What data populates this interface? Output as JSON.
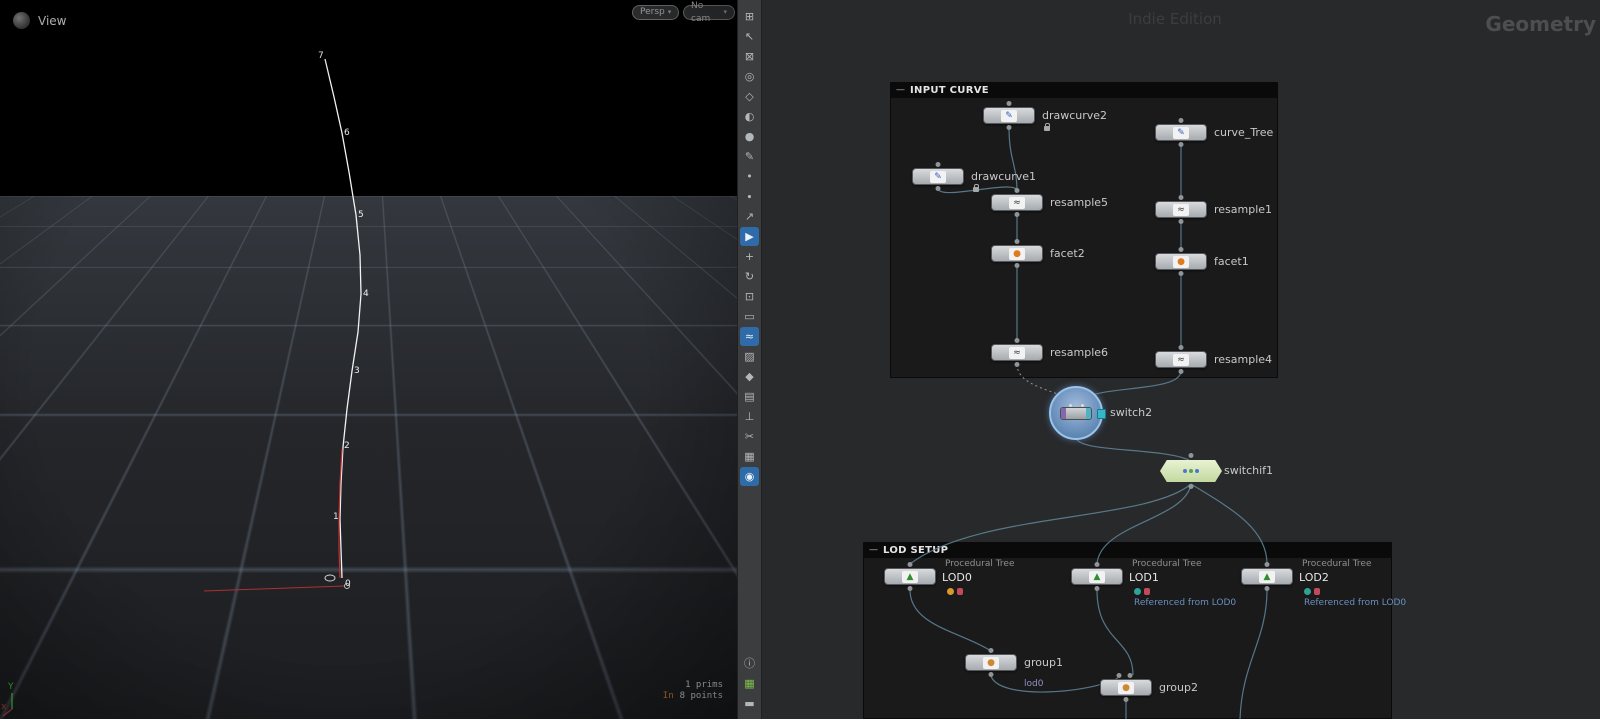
{
  "viewport": {
    "title": "View",
    "camera_button": "Persp",
    "cam_select_button": "No cam",
    "caret": "▾",
    "point_labels": [
      "7",
      "6",
      "5",
      "4",
      "3",
      "2",
      "1",
      "0"
    ],
    "stats": {
      "prims_line": "1  prims",
      "in_label": "In",
      "points_line": "8 points"
    },
    "axis": {
      "x": "x",
      "y": "Y"
    }
  },
  "toolbar": {
    "icons": [
      {
        "name": "viewport-layout-icon",
        "glyph": "⊞"
      },
      {
        "name": "cursor-icon",
        "glyph": "↖"
      },
      {
        "name": "lock-icon",
        "glyph": "⊠"
      },
      {
        "name": "pin-icon",
        "glyph": "◎"
      },
      {
        "name": "diamond-snap-icon",
        "glyph": "◇"
      },
      {
        "name": "shading-icon",
        "glyph": "◐"
      },
      {
        "name": "sphere-icon",
        "glyph": "●"
      },
      {
        "name": "pen-icon",
        "glyph": "✎"
      },
      {
        "name": "dot-icon",
        "glyph": "•"
      },
      {
        "name": "small-dot-icon",
        "glyph": "∙"
      },
      {
        "name": "arrow-tool-icon",
        "glyph": "↗"
      },
      {
        "name": "select-tool-icon",
        "glyph": "▶"
      },
      {
        "name": "translate-tool-icon",
        "glyph": "+"
      },
      {
        "name": "rotate-tool-icon",
        "glyph": "↻"
      },
      {
        "name": "scale-tool-icon",
        "glyph": "⊡"
      },
      {
        "name": "marquee-select-icon",
        "glyph": "▭"
      },
      {
        "name": "curve-tool-icon",
        "glyph": "≈"
      },
      {
        "name": "paint-tool-icon",
        "glyph": "▨"
      },
      {
        "name": "snap-icon",
        "glyph": "◆"
      },
      {
        "name": "grid-snap-icon",
        "glyph": "▤"
      },
      {
        "name": "align-tool-icon",
        "glyph": "⊥"
      },
      {
        "name": "cut-tool-icon",
        "glyph": "✂"
      },
      {
        "name": "mirror-tool-icon",
        "glyph": "▦"
      },
      {
        "name": "light-tool-icon",
        "glyph": "◉"
      },
      {
        "name": "info-icon",
        "glyph": "ⓘ"
      },
      {
        "name": "cells-icon",
        "glyph": "▦"
      },
      {
        "name": "memory-icon",
        "glyph": "▬"
      }
    ]
  },
  "network": {
    "watermark": "Indie Edition",
    "pane_title": "Geometry",
    "input_box": {
      "title": "INPUT CURVE",
      "collapse": "—"
    },
    "lod_box": {
      "title": "LOD SETUP",
      "collapse": "—"
    },
    "glyphs": {
      "draw": "✎",
      "resample": "≈",
      "facet": "●",
      "tree": "▲",
      "group": "●"
    },
    "nodes": [
      {
        "label": "drawcurve2"
      },
      {
        "label": "curve_Tree"
      },
      {
        "label": "drawcurve1"
      },
      {
        "label": "resample5"
      },
      {
        "label": "resample1"
      },
      {
        "label": "facet2"
      },
      {
        "label": "facet1"
      },
      {
        "label": "resample6"
      },
      {
        "label": "resample4"
      }
    ],
    "switch2": {
      "label": "switch2"
    },
    "switchif1": {
      "label": "switchif1"
    },
    "lods": [
      {
        "type": "Procedural Tree",
        "label": "LOD0",
        "ref": ""
      },
      {
        "type": "Procedural Tree",
        "label": "LOD1",
        "ref": "Referenced from LOD0"
      },
      {
        "type": "Procedural Tree",
        "label": "LOD2",
        "ref": "Referenced from LOD0"
      }
    ],
    "groups": [
      {
        "label": "group1",
        "sub": "lod0"
      },
      {
        "label": "group2",
        "sub": ""
      }
    ]
  }
}
